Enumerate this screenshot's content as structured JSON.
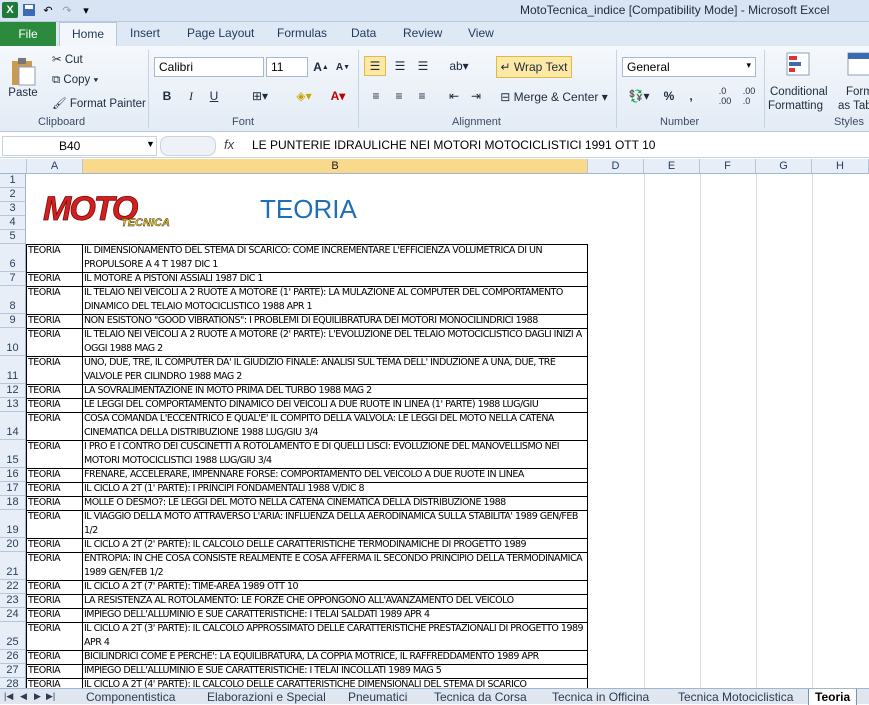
{
  "window": {
    "title": "MotoTecnica_indice  [Compatibility Mode]  -  Microsoft Excel"
  },
  "tabs": [
    "File",
    "Home",
    "Insert",
    "Page Layout",
    "Formulas",
    "Data",
    "Review",
    "View"
  ],
  "ribbon": {
    "clipboard": {
      "paste": "Paste",
      "cut": "Cut",
      "copy": "Copy",
      "format_painter": "Format Painter",
      "label": "Clipboard"
    },
    "font": {
      "name": "Calibri",
      "size": "11",
      "bold": "B",
      "italic": "I",
      "underline": "U",
      "label": "Font"
    },
    "alignment": {
      "wrap_text": "Wrap Text",
      "merge_center": "Merge & Center",
      "label": "Alignment"
    },
    "number": {
      "format": "General",
      "percent": "%",
      "comma": ",",
      "label": "Number"
    },
    "styles": {
      "conditional": "Conditional",
      "formatting": "Formatting",
      "format": "Form",
      "as_table": "as Tab",
      "label": "Styles"
    }
  },
  "formula_bar": {
    "name_box": "B40",
    "fx": "fx",
    "content": "LE PUNTERIE IDRAULICHE NEI MOTORI MOTOCICLISTICI 1991 OTT 10"
  },
  "columns": [
    "A",
    "B",
    "D",
    "E",
    "F",
    "G",
    "H"
  ],
  "header": {
    "logo_text": "MOTO",
    "logo_sub": "TECNICA",
    "title": "TEORIA"
  },
  "rows": [
    {
      "n": "1"
    },
    {
      "n": "2"
    },
    {
      "n": "3"
    },
    {
      "n": "4"
    },
    {
      "n": "5"
    },
    {
      "n": "6",
      "a": "TEORIA",
      "b": "IL DIMENSIONAMENTO DEL STEMA DI SCARICO: COME INCREMENTARE L'EFFICIENZA VOLUMETRICA DI UN PROPULSORE A 4 T 1987 DIC 1"
    },
    {
      "n": "7",
      "a": "TEORIA",
      "b": "IL MOTORE A PISTONI ASSIALI 1987 DIC 1"
    },
    {
      "n": "8",
      "a": "TEORIA",
      "b": "IL TELAIO NEI VEICOLI A 2 RUOTE A MOTORE (1' PARTE): LA MULAZIONE AL COMPUTER DEL COMPORTAMENTO DINAMICO DEL TELAIO MOTOCICLISTICO 1988 APR 1"
    },
    {
      "n": "9",
      "a": "TEORIA",
      "b": "NON ESISTONO \"GOOD VIBRATIONS\": I PROBLEMI DI EQUILIBRATURA DEI MOTORI MONOCILINDRICI 1988"
    },
    {
      "n": "10",
      "a": "TEORIA",
      "b": "IL TELAIO NEI VEICOLI A 2 RUOTE A MOTORE (2' PARTE): L'EVOLUZIONE DEL TELAIO MOTOCICLISTICO DAGLI INIZI A OGGI 1988 MAG 2"
    },
    {
      "n": "11",
      "a": "TEORIA",
      "b": "UNO, DUE, TRE, IL COMPUTER DA' IL GIUDIZIO FINALE: ANALISI SUL TEMA DELL' INDUZIONE A UNA, DUE, TRE VALVOLE PER CILINDRO 1988 MAG 2"
    },
    {
      "n": "12",
      "a": "TEORIA",
      "b": "LA SOVRALIMENTAZIONE IN MOTO PRIMA DEL TURBO 1988 MAG 2"
    },
    {
      "n": "13",
      "a": "TEORIA",
      "b": "LE LEGGI DEL COMPORTAMENTO DINAMICO DEI VEICOLI A DUE RUOTE IN LINEA (1' PARTE) 1988 LUG/GIU"
    },
    {
      "n": "14",
      "a": "TEORIA",
      "b": "COSA COMANDA L'ECCENTRICO E QUAL'E' IL COMPITO DELLA VALVOLA: LE LEGGI DEL MOTO NELLA CATENA CINEMATICA DELLA DISTRIBUZIONE 1988 LUG/GIU 3/4"
    },
    {
      "n": "15",
      "a": "TEORIA",
      "b": "I PRO E I CONTRO DEI CUSCINETTI A ROTOLAMENTO E DI QUELLI LISCI: EVOLUZIONE DEL MANOVELLISMO NEI MOTORI MOTOCICLISTICI 1988 LUG/GIU 3/4"
    },
    {
      "n": "16",
      "a": "TEORIA",
      "b": "FRENARE, ACCELERARE, IMPENNARE FORSE: COMPORTAMENTO DEL VEICOLO A DUE RUOTE IN LINEA"
    },
    {
      "n": "17",
      "a": "TEORIA",
      "b": "IL CICLO A 2T (1' PARTE): I PRINCIPI FONDAMENTALI 1988 V/DIC 8"
    },
    {
      "n": "18",
      "a": "TEORIA",
      "b": "MOLLE O DESMO?: LE LEGGI DEL MOTO NELLA CATENA CINEMATICA DELLA DISTRIBUZIONE 1988"
    },
    {
      "n": "19",
      "a": "TEORIA",
      "b": "IL VIAGGIO DELLA MOTO ATTRAVERSO L'ARIA: INFLUENZA DELLA AERODINAMICA SULLA STABILITA' 1989 GEN/FEB 1/2"
    },
    {
      "n": "20",
      "a": "TEORIA",
      "b": "IL CICLO A 2T (2' PARTE): IL CALCOLO DELLE CARATTERISTICHE TERMODINAMICHE DI PROGETTO 1989"
    },
    {
      "n": "21",
      "a": "TEORIA",
      "b": "ENTROPIA: IN CHE COSA CONSISTE REALMENTE E COSA AFFERMA IL SECONDO PRINCIPIO DELLA TERMODINAMICA 1989 GEN/FEB 1/2"
    },
    {
      "n": "22",
      "a": "TEORIA",
      "b": "IL CICLO A 2T (7' PARTE): TIME-AREA 1989 OTT 10"
    },
    {
      "n": "23",
      "a": "TEORIA",
      "b": "LA RESISTENZA AL ROTOLAMENTO: LE FORZE CHE  OPPONGONO ALL'AVANZAMENTO DEL VEICOLO"
    },
    {
      "n": "24",
      "a": "TEORIA",
      "b": "IMPIEGO DELL'ALLUMINIO E SUE CARATTERISTICHE: I TELAI SALDATI 1989 APR 4"
    },
    {
      "n": "25",
      "a": "TEORIA",
      "b": "IL CICLO A 2T (3' PARTE): IL CALCOLO APPROSSIMATO DELLE CARATTERISTICHE PRESTAZIONALI DI PROGETTO 1989 APR 4"
    },
    {
      "n": "26",
      "a": "TEORIA",
      "b": "BICILINDRICI COME E PERCHE': LA EQUILIBRATURA, LA COPPIA MOTRICE, IL RAFFREDDAMENTO 1989 APR"
    },
    {
      "n": "27",
      "a": "TEORIA",
      "b": "IMPIEGO DELL'ALLUMINIO E SUE CARATTERISTICHE: I TELAI INCOLLATI 1989 MAG 5"
    },
    {
      "n": "28",
      "a": "TEORIA",
      "b": "IL CICLO A 2T (4' PARTE): IL CALCOLO DELLE CARATTERISTICHE DIMENSIONALI DEL STEMA DI SCARICO"
    }
  ],
  "sheets": [
    "Componentistica",
    "Elaborazioni e Special",
    "Pneumatici",
    "Tecnica da Corsa",
    "Tecnica in Officina",
    "Tecnica Motociclistica",
    "Teoria"
  ]
}
